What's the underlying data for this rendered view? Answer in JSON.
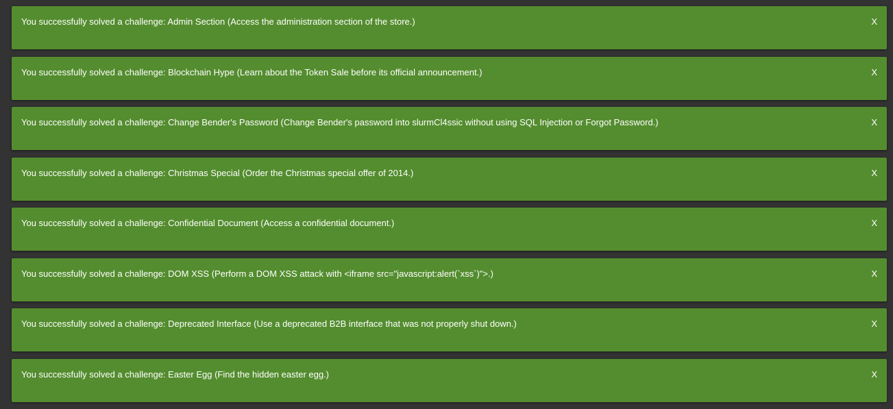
{
  "colors": {
    "background": "#333333",
    "toast_background": "#548d2f",
    "text": "#ffffff"
  },
  "notifications": [
    {
      "message": "You successfully solved a challenge: Admin Section (Access the administration section of the store.)",
      "close_label": "X"
    },
    {
      "message": "You successfully solved a challenge: Blockchain Hype (Learn about the Token Sale before its official announcement.)",
      "close_label": "X"
    },
    {
      "message": "You successfully solved a challenge: Change Bender's Password (Change Bender's password into slurmCl4ssic without using SQL Injection or Forgot Password.)",
      "close_label": "X"
    },
    {
      "message": "You successfully solved a challenge: Christmas Special (Order the Christmas special offer of 2014.)",
      "close_label": "X"
    },
    {
      "message": "You successfully solved a challenge: Confidential Document (Access a confidential document.)",
      "close_label": "X"
    },
    {
      "message": "You successfully solved a challenge: DOM XSS (Perform a DOM XSS attack with <iframe src=\"javascript:alert(`xss`)\">.)",
      "close_label": "X"
    },
    {
      "message": "You successfully solved a challenge: Deprecated Interface (Use a deprecated B2B interface that was not properly shut down.)",
      "close_label": "X"
    },
    {
      "message": "You successfully solved a challenge: Easter Egg (Find the hidden easter egg.)",
      "close_label": "X"
    }
  ]
}
